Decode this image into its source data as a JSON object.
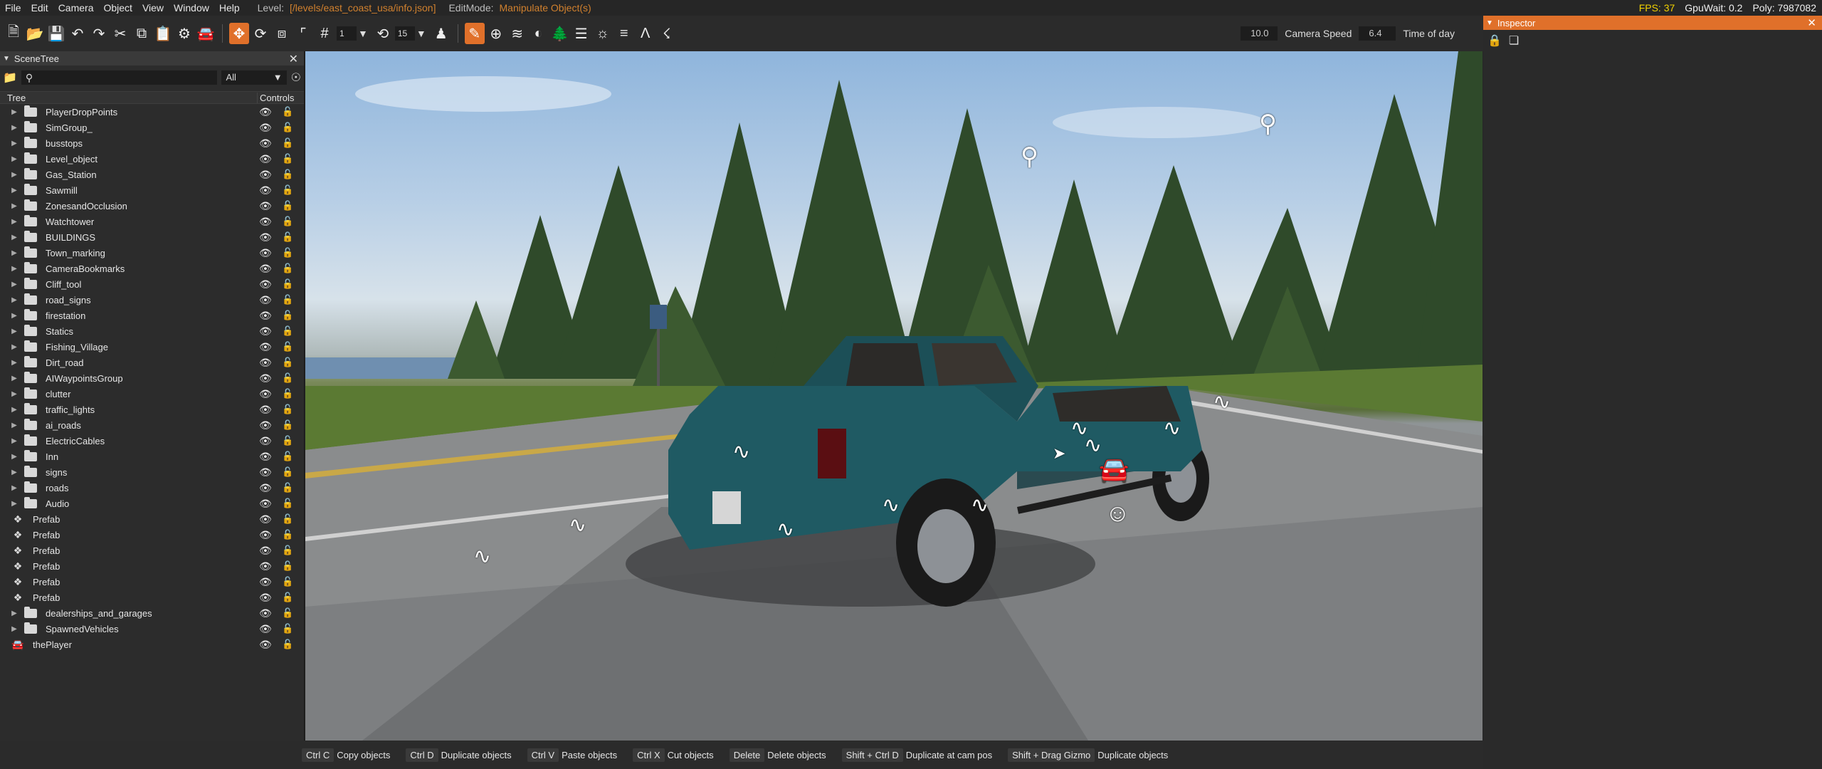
{
  "menubar": {
    "items": [
      "File",
      "Edit",
      "Camera",
      "Object",
      "View",
      "Window",
      "Help"
    ],
    "level_label": "Level:",
    "level_value": "[/levels/east_coast_usa/info.json]",
    "editmode_label": "EditMode:",
    "editmode_value": "Manipulate Object(s)",
    "fps": "FPS: 37",
    "gpuwait": "GpuWait: 0.2",
    "poly": "Poly: 7987082"
  },
  "toolbar": {
    "grid_value": "1",
    "rotation_value": "15",
    "speed_field": "10.0",
    "camera_speed_label": "Camera Speed",
    "time_field": "6.4",
    "time_label": "Time of day"
  },
  "scenetree": {
    "title": "SceneTree",
    "filter_value": "All",
    "col_tree": "Tree",
    "col_controls": "Controls",
    "rows": [
      {
        "name": "PlayerDropPoints",
        "type": "folder"
      },
      {
        "name": "SimGroup_",
        "type": "folder"
      },
      {
        "name": "busstops",
        "type": "folder"
      },
      {
        "name": "Level_object",
        "type": "folder"
      },
      {
        "name": "Gas_Station",
        "type": "folder"
      },
      {
        "name": "Sawmill",
        "type": "folder"
      },
      {
        "name": "ZonesandOcclusion",
        "type": "folder"
      },
      {
        "name": "Watchtower",
        "type": "folder"
      },
      {
        "name": "BUILDINGS",
        "type": "folder"
      },
      {
        "name": "Town_marking",
        "type": "folder"
      },
      {
        "name": "CameraBookmarks",
        "type": "folder"
      },
      {
        "name": "Cliff_tool",
        "type": "folder"
      },
      {
        "name": "road_signs",
        "type": "folder"
      },
      {
        "name": "firestation",
        "type": "folder"
      },
      {
        "name": "Statics",
        "type": "folder"
      },
      {
        "name": "Fishing_Village",
        "type": "folder"
      },
      {
        "name": "Dirt_road",
        "type": "folder"
      },
      {
        "name": "AIWaypointsGroup",
        "type": "folder"
      },
      {
        "name": "clutter",
        "type": "folder"
      },
      {
        "name": "traffic_lights",
        "type": "folder"
      },
      {
        "name": "ai_roads",
        "type": "folder"
      },
      {
        "name": "ElectricCables",
        "type": "folder"
      },
      {
        "name": "Inn",
        "type": "folder"
      },
      {
        "name": "signs",
        "type": "folder"
      },
      {
        "name": "roads",
        "type": "folder"
      },
      {
        "name": "Audio",
        "type": "folder"
      },
      {
        "name": "Prefab",
        "type": "prefab"
      },
      {
        "name": "Prefab",
        "type": "prefab"
      },
      {
        "name": "Prefab",
        "type": "prefab"
      },
      {
        "name": "Prefab",
        "type": "prefab"
      },
      {
        "name": "Prefab",
        "type": "prefab"
      },
      {
        "name": "Prefab",
        "type": "prefab"
      },
      {
        "name": "dealerships_and_garages",
        "type": "folder"
      },
      {
        "name": "SpawnedVehicles",
        "type": "folder"
      },
      {
        "name": "thePlayer",
        "type": "vehicle"
      }
    ]
  },
  "inspector": {
    "title": "Inspector"
  },
  "statusbar": {
    "shortcuts": [
      {
        "key": "Ctrl C",
        "desc": "Copy objects"
      },
      {
        "key": "Ctrl D",
        "desc": "Duplicate objects"
      },
      {
        "key": "Ctrl V",
        "desc": "Paste objects"
      },
      {
        "key": "Ctrl X",
        "desc": "Cut objects"
      },
      {
        "key": "Delete",
        "desc": "Delete objects"
      },
      {
        "key": "Shift + Ctrl D",
        "desc": "Duplicate at cam pos"
      },
      {
        "key": "Shift + Drag Gizmo",
        "desc": "Duplicate objects"
      }
    ]
  },
  "colors": {
    "accent": "#e0702a",
    "level_text": "#d0802e",
    "fps_text": "#f0d000",
    "truck_body": "#1f5a63"
  }
}
